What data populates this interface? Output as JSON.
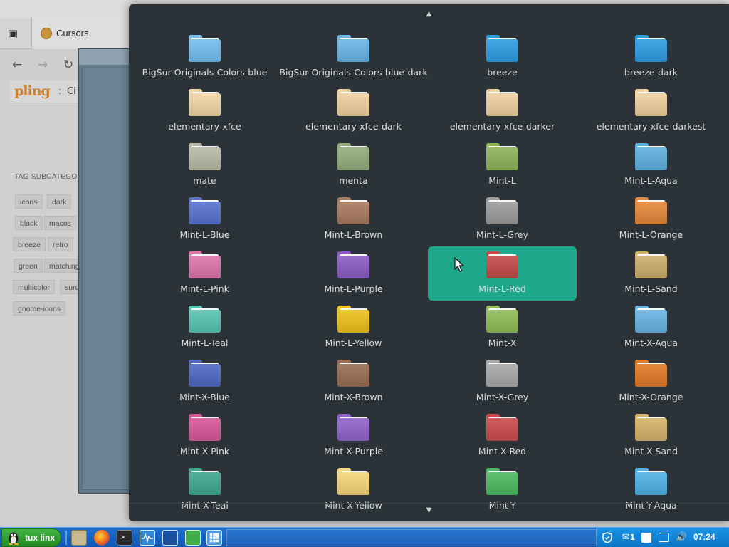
{
  "browser": {
    "tab_title": "Cursors",
    "breadcrumb": "Ci",
    "logo_text": "pling",
    "logo_separator": ":",
    "tag_heading": "TAG SUBCATEGORI",
    "tags": [
      "icons",
      "dark",
      "black",
      "macos",
      "breeze",
      "retro",
      "green",
      "matching",
      "multicolor",
      "suru",
      "gnome-icons"
    ]
  },
  "icon_picker": {
    "items": [
      {
        "label": "BigSur-Originals-Colors-blue",
        "color": "#72bff0"
      },
      {
        "label": "BigSur-Originals-Colors-blue-dark",
        "color": "#6ab6e8"
      },
      {
        "label": "breeze",
        "color": "#2d9de0"
      },
      {
        "label": "breeze-dark",
        "color": "#2d9de0"
      },
      {
        "label": "elementary-xfce",
        "color": "#f3d6a5"
      },
      {
        "label": "elementary-xfce-dark",
        "color": "#f1d2a0"
      },
      {
        "label": "elementary-xfce-darker",
        "color": "#f1d2a0"
      },
      {
        "label": "elementary-xfce-darkest",
        "color": "#f1d2a0"
      },
      {
        "label": "mate",
        "color": "#b9baa5"
      },
      {
        "label": "menta",
        "color": "#93ac7c"
      },
      {
        "label": "Mint-L",
        "color": "#8cb55a"
      },
      {
        "label": "Mint-L-Aqua",
        "color": "#5fb0df"
      },
      {
        "label": "Mint-L-Blue",
        "color": "#5672cc"
      },
      {
        "label": "Mint-L-Brown",
        "color": "#a87a5e"
      },
      {
        "label": "Mint-L-Grey",
        "color": "#9b9b9b"
      },
      {
        "label": "Mint-L-Orange",
        "color": "#e4883a"
      },
      {
        "label": "Mint-L-Pink",
        "color": "#de75ac"
      },
      {
        "label": "Mint-L-Purple",
        "color": "#8d5cc5"
      },
      {
        "label": "Mint-L-Red",
        "color": "#c44a4a"
      },
      {
        "label": "Mint-L-Sand",
        "color": "#cdae6b"
      },
      {
        "label": "Mint-L-Teal",
        "color": "#59c5b2"
      },
      {
        "label": "Mint-L-Yellow",
        "color": "#eec21b"
      },
      {
        "label": "Mint-X",
        "color": "#8fbd56"
      },
      {
        "label": "Mint-X-Aqua",
        "color": "#6ab4e4"
      },
      {
        "label": "Mint-X-Blue",
        "color": "#4e68c4"
      },
      {
        "label": "Mint-X-Brown",
        "color": "#9b6d52"
      },
      {
        "label": "Mint-X-Grey",
        "color": "#a9a9a9"
      },
      {
        "label": "Mint-X-Orange",
        "color": "#e37a25"
      },
      {
        "label": "Mint-X-Pink",
        "color": "#d9579a"
      },
      {
        "label": "Mint-X-Purple",
        "color": "#9163cc"
      },
      {
        "label": "Mint-X-Red",
        "color": "#cc4b4b"
      },
      {
        "label": "Mint-X-Sand",
        "color": "#d8b46a"
      },
      {
        "label": "Mint-X-Teal",
        "color": "#3fa88e"
      },
      {
        "label": "Mint-X-Yellow",
        "color": "#f6d77a"
      },
      {
        "label": "Mint-Y",
        "color": "#4cb960"
      },
      {
        "label": "Mint-Y-Aqua",
        "color": "#4fb3e6"
      }
    ],
    "selected": "Mint-L-Red",
    "selection_color": "#1fa78b",
    "background_color": "#2b3338"
  },
  "taskbar": {
    "start_label": "tux linx",
    "clock": "07:24",
    "notification_count": "1"
  }
}
